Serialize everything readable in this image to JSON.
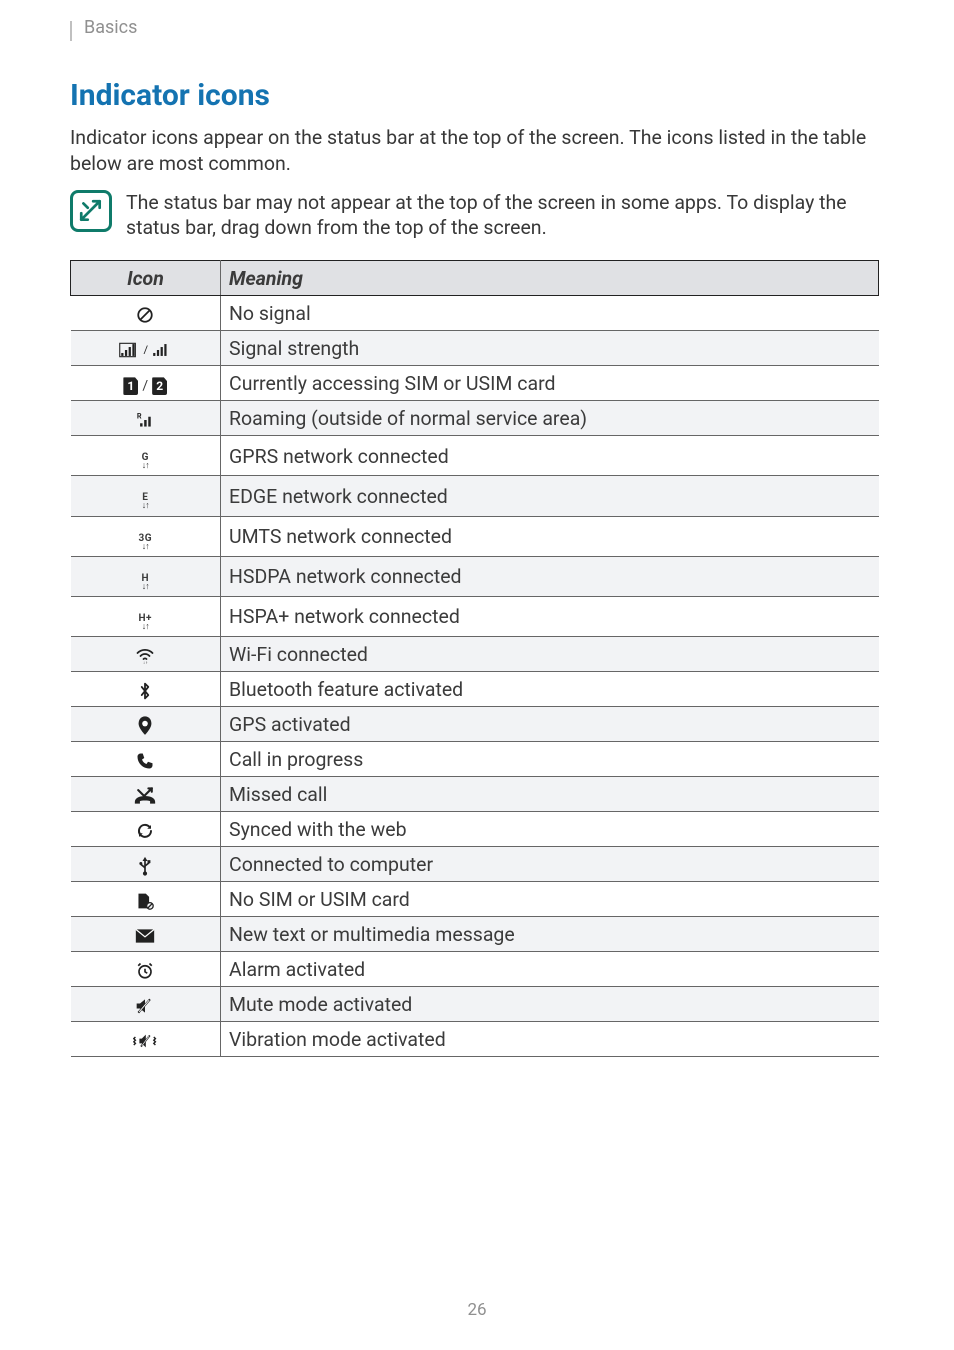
{
  "header": {
    "breadcrumb": "Basics"
  },
  "section": {
    "title": "Indicator icons",
    "intro": "Indicator icons appear on the status bar at the top of the screen. The icons listed in the table below are most common.",
    "note": "The status bar may not appear at the top of the screen in some apps. To display the status bar, drag down from the top of the screen."
  },
  "table": {
    "head_icon": "Icon",
    "head_meaning": "Meaning",
    "rows": [
      {
        "icon": "no-signal-icon",
        "meaning": "No signal"
      },
      {
        "icon": "signal-strength-icon",
        "meaning": "Signal strength"
      },
      {
        "icon": "sim-access-icon",
        "meaning": "Currently accessing SIM or USIM card"
      },
      {
        "icon": "roaming-icon",
        "meaning": "Roaming (outside of normal service area)"
      },
      {
        "icon": "gprs-icon",
        "meaning": "GPRS network connected"
      },
      {
        "icon": "edge-icon",
        "meaning": "EDGE network connected"
      },
      {
        "icon": "umts-icon",
        "meaning": "UMTS network connected"
      },
      {
        "icon": "hsdpa-icon",
        "meaning": "HSDPA network connected"
      },
      {
        "icon": "hspa-plus-icon",
        "meaning": "HSPA+ network connected"
      },
      {
        "icon": "wifi-icon",
        "meaning": "Wi-Fi connected"
      },
      {
        "icon": "bluetooth-icon",
        "meaning": "Bluetooth feature activated"
      },
      {
        "icon": "gps-icon",
        "meaning": "GPS activated"
      },
      {
        "icon": "call-icon",
        "meaning": "Call in progress"
      },
      {
        "icon": "missed-call-icon",
        "meaning": "Missed call"
      },
      {
        "icon": "sync-icon",
        "meaning": "Synced with the web"
      },
      {
        "icon": "usb-icon",
        "meaning": "Connected to computer"
      },
      {
        "icon": "no-sim-icon",
        "meaning": "No SIM or USIM card"
      },
      {
        "icon": "message-icon",
        "meaning": "New text or multimedia message"
      },
      {
        "icon": "alarm-icon",
        "meaning": "Alarm activated"
      },
      {
        "icon": "mute-icon",
        "meaning": "Mute mode activated"
      },
      {
        "icon": "vibration-icon",
        "meaning": "Vibration mode activated"
      }
    ]
  },
  "page_number": "26"
}
